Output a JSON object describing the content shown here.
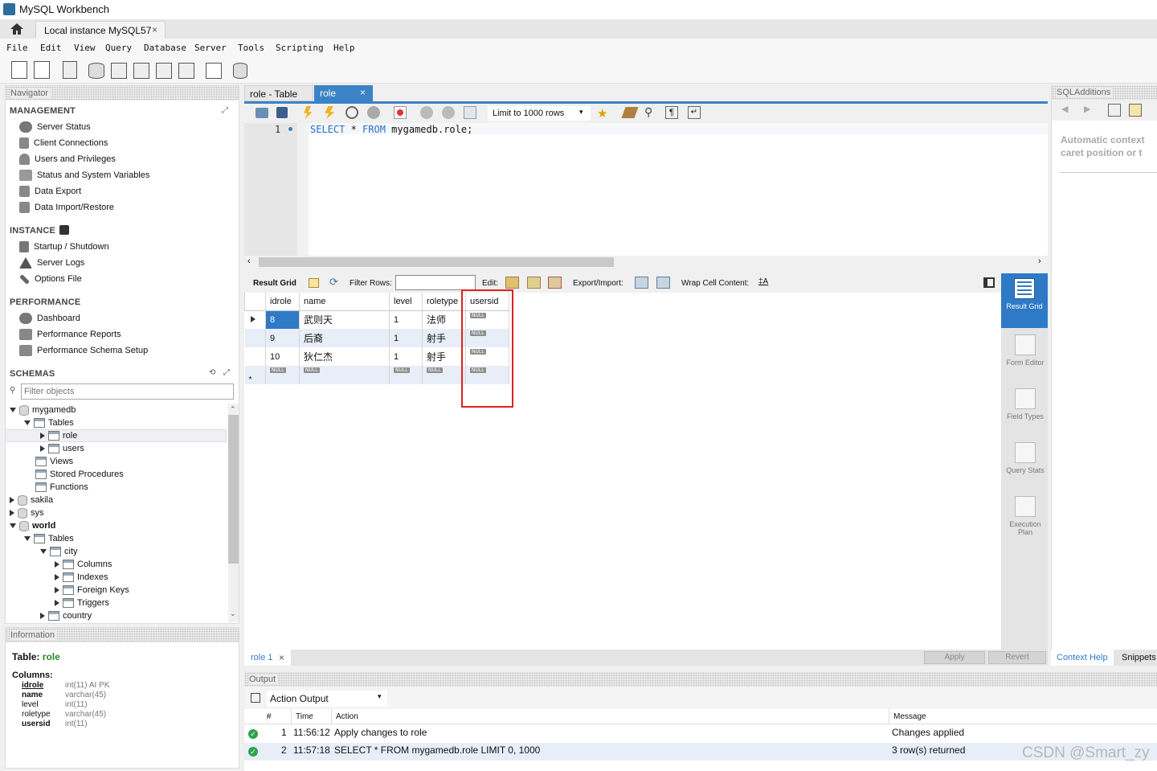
{
  "window": {
    "title": "MySQL Workbench"
  },
  "tabs": {
    "connection": "Local instance MySQL57"
  },
  "menu": [
    "File",
    "Edit",
    "View",
    "Query",
    "Database",
    "Server",
    "Tools",
    "Scripting",
    "Help"
  ],
  "navigator": {
    "header": "Navigator",
    "management": {
      "title": "MANAGEMENT",
      "items": [
        "Server Status",
        "Client Connections",
        "Users and Privileges",
        "Status and System Variables",
        "Data Export",
        "Data Import/Restore"
      ]
    },
    "instance": {
      "title": "INSTANCE",
      "items": [
        "Startup / Shutdown",
        "Server Logs",
        "Options File"
      ]
    },
    "performance": {
      "title": "PERFORMANCE",
      "items": [
        "Dashboard",
        "Performance Reports",
        "Performance Schema Setup"
      ]
    },
    "schemas": {
      "title": "SCHEMAS",
      "filter_placeholder": "Filter objects",
      "tree": [
        "mygamedb",
        "Tables",
        "role",
        "users",
        "Views",
        "Stored Procedures",
        "Functions",
        "sakila",
        "sys",
        "world",
        "Tables",
        "city",
        "Columns",
        "Indexes",
        "Foreign Keys",
        "Triggers",
        "country"
      ]
    }
  },
  "information": {
    "header": "Information",
    "table_label": "Table:",
    "table_name": "role",
    "columns_label": "Columns:",
    "columns": [
      {
        "name": "idrole",
        "type": "int(11) AI PK"
      },
      {
        "name": "name",
        "type": "varchar(45)"
      },
      {
        "name": "level",
        "type": "int(11)"
      },
      {
        "name": "roletype",
        "type": "varchar(45)"
      },
      {
        "name": "usersid",
        "type": "int(11)"
      }
    ]
  },
  "editor": {
    "tabs": [
      "role - Table",
      "role"
    ],
    "limit": "Limit to 1000 rows",
    "line_no": "1",
    "sql": {
      "kw1": "SELECT",
      "star": " * ",
      "kw2": "FROM",
      "rest": " mygamedb.role;"
    }
  },
  "result_toolbar": {
    "result_grid": "Result Grid",
    "filter_rows": "Filter Rows:",
    "edit": "Edit:",
    "export": "Export/Import:",
    "wrap": "Wrap Cell Content:"
  },
  "grid": {
    "columns": [
      "idrole",
      "name",
      "level",
      "roletype",
      "usersid"
    ],
    "rows": [
      [
        "8",
        "武则天",
        "1",
        "法师"
      ],
      [
        "9",
        "后裔",
        "1",
        "射手"
      ],
      [
        "10",
        "狄仁杰",
        "1",
        "射手"
      ]
    ],
    "null_label": "NULL"
  },
  "side_views": [
    "Result Grid",
    "Form Editor",
    "Field Types",
    "Query Stats",
    "Execution Plan"
  ],
  "result_tabs": {
    "tab": "role 1",
    "apply": "Apply",
    "revert": "Revert"
  },
  "sqladditions": {
    "header": "SQLAdditions",
    "msg_line1": "Automatic context",
    "msg_line2": "caret position or t",
    "context_help": "Context Help",
    "snippets": "Snippets"
  },
  "output": {
    "header": "Output",
    "selector": "Action Output",
    "columns": {
      "num": "#",
      "time": "Time",
      "action": "Action",
      "message": "Message"
    },
    "rows": [
      {
        "num": "1",
        "time": "11:56:12",
        "action": "Apply changes to role",
        "message": "Changes applied"
      },
      {
        "num": "2",
        "time": "11:57:18",
        "action": "SELECT * FROM mygamedb.role LIMIT 0, 1000",
        "message": "3 row(s) returned"
      }
    ]
  },
  "watermark": "CSDN @Smart_zy",
  "colors": {
    "accent": "#2f7ac6",
    "highlight": "#e02020",
    "keyword": "#2a6fc9"
  }
}
